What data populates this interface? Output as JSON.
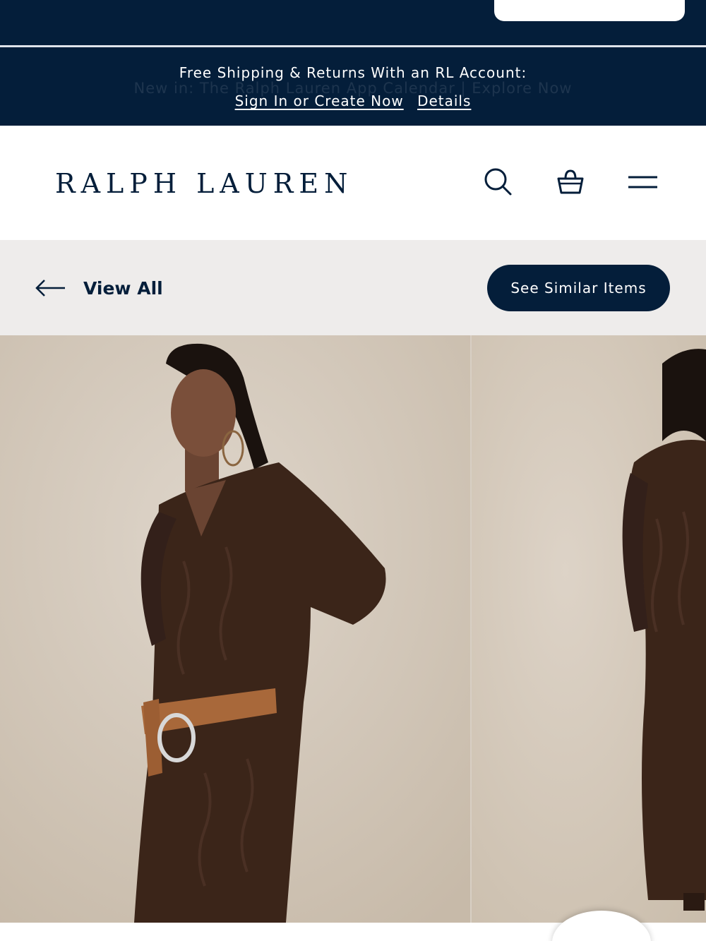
{
  "promo": {
    "headline": "Free Shipping & Returns With an RL Account:",
    "ghost_text": "New in: The Ralph Lauren App Calendar | Explore Now",
    "signin_link": "Sign In or Create Now",
    "details_link": "Details"
  },
  "header": {
    "logo": "RALPH LAUREN",
    "icons": [
      "search-icon",
      "shopping-bag-icon",
      "hamburger-menu-icon"
    ]
  },
  "navbar": {
    "back_label": "View All",
    "similar_button": "See Similar Items"
  },
  "gallery": {
    "images": [
      "model-front-brown-cable-knit-dress",
      "model-back-brown-cable-knit-dress"
    ]
  },
  "colors": {
    "navy": "#041e3a",
    "nav_bg": "#eeeceb",
    "backdrop": "#d8cfc4",
    "sweater": "#3b2519",
    "belt": "#a8683a"
  }
}
